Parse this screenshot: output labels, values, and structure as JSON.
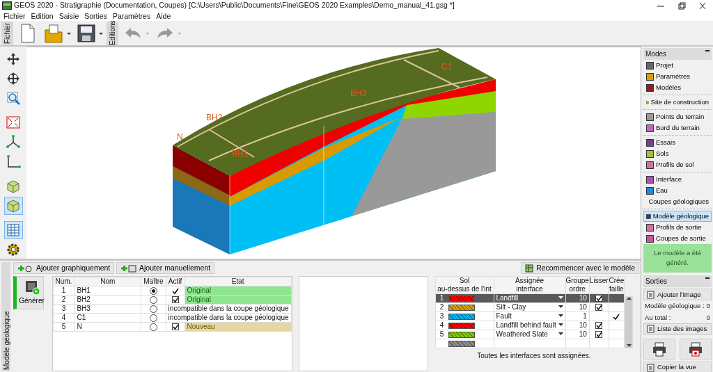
{
  "window": {
    "title": "GEOS 2020 - Stratigraphie (Documentation, Coupes) [C:\\Users\\Public\\Documents\\Fine\\GEOS 2020 Examples\\Demo_manual_41.gsg *]"
  },
  "menu": [
    "Fichier",
    "Edition",
    "Saisie",
    "Sorties",
    "Paramètres",
    "Aide"
  ],
  "toolbar": {
    "groups": [
      {
        "label": "Fichier",
        "tools": [
          {
            "kind": "new"
          },
          {
            "kind": "open"
          },
          {
            "kind": "save"
          }
        ]
      },
      {
        "label": "Editions",
        "tools": [
          {
            "kind": "undo"
          },
          {
            "kind": "redo"
          }
        ]
      }
    ]
  },
  "tools": [
    {
      "kind": "move",
      "selected": false
    },
    {
      "kind": "rotate",
      "selected": false
    },
    {
      "kind": "zoom",
      "selected": false
    },
    {
      "kind": "fit",
      "selected": false
    },
    {
      "kind": "axes3d",
      "selected": false
    },
    {
      "kind": "axes2d",
      "selected": false
    },
    {
      "kind": "cube",
      "selected": false
    },
    {
      "kind": "cube",
      "selected": true
    },
    {
      "kind": "table",
      "selected": true
    },
    {
      "kind": "gear",
      "selected": false
    }
  ],
  "model": {
    "labels": [
      {
        "text": "C1"
      },
      {
        "text": "BH3"
      },
      {
        "text": "BH2"
      },
      {
        "text": "N"
      },
      {
        "text": "BH1"
      }
    ]
  },
  "modes": {
    "title": "Modes",
    "groups": [
      [
        {
          "label": "Projet",
          "selected": false
        },
        {
          "label": "Paramètres",
          "selected": false
        },
        {
          "label": "Modèles",
          "selected": false
        }
      ],
      [
        {
          "label": "Site de construction",
          "selected": false
        }
      ],
      [
        {
          "label": "Points du terrain",
          "selected": false
        },
        {
          "label": "Bord du terrain",
          "selected": false
        }
      ],
      [
        {
          "label": "Essais",
          "selected": false
        },
        {
          "label": "Sols",
          "selected": false
        },
        {
          "label": "Profils de sol",
          "selected": false
        }
      ],
      [
        {
          "label": "Interface",
          "selected": false
        },
        {
          "label": "Eau",
          "selected": false
        },
        {
          "label": "Coupes géologiques",
          "selected": false
        }
      ],
      [
        {
          "label": "Modèle géologique",
          "selected": true
        },
        {
          "label": "Profils de sortie",
          "selected": false
        },
        {
          "label": "Coupes de sortie",
          "selected": false
        }
      ]
    ]
  },
  "status_message": "Le modèle a été généré.",
  "outputs": {
    "title": "Sorties",
    "add_button": "Ajouter l'image",
    "counts": [
      {
        "label": "Modèle géologique :",
        "value": "0"
      },
      {
        "label": "Au total :",
        "value": "0"
      }
    ],
    "list_button": "Liste des images",
    "copy_button": "Copier la vue"
  },
  "bottom": {
    "side_tab": "Modèle géologique",
    "add_buttons": [
      "Ajouter graphiquement",
      "Ajouter manuellement"
    ],
    "restart_button": "Recommencer avec le modèle",
    "generate_button": "Générer",
    "boreholes": {
      "columns": [
        "Num.",
        "Nom",
        "Maître",
        "Actif",
        "Etat"
      ],
      "rows": [
        {
          "num": "1",
          "name": "BH1",
          "master": true,
          "kind": "original",
          "active": true,
          "locked": true,
          "state": "Original"
        },
        {
          "num": "2",
          "name": "BH2",
          "master": false,
          "kind": "original",
          "active": true,
          "locked": false,
          "state": "Original"
        },
        {
          "num": "3",
          "name": "BH3",
          "master": false,
          "kind": "incompatible",
          "state": "incompatible dans la coupe géologique"
        },
        {
          "num": "4",
          "name": "C1",
          "master": false,
          "kind": "incompatible",
          "state": "incompatible dans la coupe géologique"
        },
        {
          "num": "5",
          "name": "N",
          "master": false,
          "kind": "new",
          "active": true,
          "locked": false,
          "state": "Nouveau"
        }
      ]
    },
    "interfaces": {
      "columns": [
        {
          "line1": "Sol",
          "line2": "au-dessus de l'int"
        },
        {
          "line1": "Assignée",
          "line2": "interface"
        },
        {
          "line1": "Groupe",
          "line2": "ordre"
        },
        {
          "line1": "Lisser"
        },
        {
          "line1": "Crée",
          "line2": "faille"
        }
      ],
      "rows": [
        {
          "num": "1",
          "color": "#ff0000",
          "interface": "Landfill",
          "order": "10",
          "smooth": true,
          "fault": false,
          "selected": true
        },
        {
          "num": "2",
          "color": "#d4a000",
          "interface": "Silt - Clay",
          "order": "10",
          "smooth": true,
          "fault": false,
          "selected": false
        },
        {
          "num": "3",
          "color": "#00b4f0",
          "interface": "Fault",
          "order": "1",
          "smooth": false,
          "fault": true,
          "selected": false
        },
        {
          "num": "4",
          "color": "#ff0000",
          "interface": "Landfill behind fault",
          "order": "10",
          "smooth": true,
          "fault": false,
          "selected": false
        },
        {
          "num": "5",
          "color": "#7ccc00",
          "interface": "Weathered Slate",
          "order": "10",
          "smooth": true,
          "fault": false,
          "selected": false
        },
        {
          "color": "#8c8c8c",
          "selected": false
        }
      ],
      "footer": "Toutes les interfaces sont assignées."
    }
  }
}
